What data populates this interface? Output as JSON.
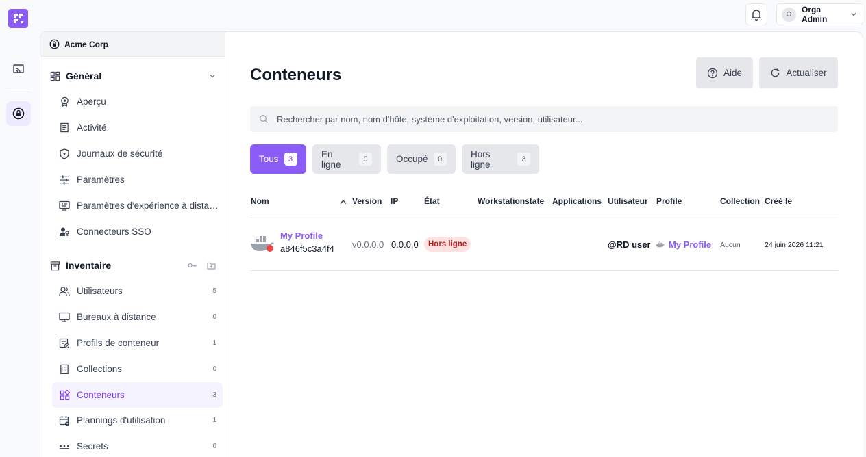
{
  "colors": {
    "accent": "#8b5cf6",
    "offline_bg": "#fee2e2",
    "offline_text": "#b91c1c",
    "offline_dot": "#ef4444"
  },
  "header": {
    "user_initial": "O",
    "user_name": "Orga Admin"
  },
  "sidebar": {
    "org_name": "Acme Corp",
    "general": {
      "title": "Général",
      "items": [
        {
          "label": "Aperçu",
          "icon": "overview-icon"
        },
        {
          "label": "Activité",
          "icon": "activity-icon"
        },
        {
          "label": "Journaux de sécurité",
          "icon": "shield-icon"
        },
        {
          "label": "Paramètres",
          "icon": "sliders-icon"
        },
        {
          "label": "Paramètres d'expérience à distance",
          "icon": "remote-settings-icon"
        },
        {
          "label": "Connecteurs SSO",
          "icon": "user-key-icon"
        }
      ]
    },
    "inventory": {
      "title": "Inventaire",
      "items": [
        {
          "label": "Utilisateurs",
          "count": "5",
          "icon": "users-icon"
        },
        {
          "label": "Bureaux à distance",
          "count": "0",
          "icon": "monitor-icon"
        },
        {
          "label": "Profils de conteneur",
          "count": "1",
          "icon": "container-profile-icon"
        },
        {
          "label": "Collections",
          "count": "0",
          "icon": "collections-icon"
        },
        {
          "label": "Conteneurs",
          "count": "3",
          "icon": "containers-icon",
          "active": true
        },
        {
          "label": "Plannings d'utilisation",
          "count": "1",
          "icon": "calendar-icon"
        },
        {
          "label": "Secrets",
          "count": "0",
          "icon": "secrets-icon"
        }
      ]
    }
  },
  "main": {
    "title": "Conteneurs",
    "help_label": "Aide",
    "refresh_label": "Actualiser",
    "search_placeholder": "Rechercher par nom, nom d'hôte, système d'exploitation, version, utilisateur...",
    "filters": [
      {
        "label": "Tous",
        "count": "3",
        "active": true
      },
      {
        "label": "En ligne",
        "count": "0"
      },
      {
        "label": "Occupé",
        "count": "0"
      },
      {
        "label": "Hors ligne",
        "count": "3"
      }
    ],
    "table": {
      "columns": [
        "Nom",
        "Version",
        "IP",
        "État",
        "Workstationstate",
        "Applications",
        "Utilisateur",
        "Profile",
        "Collection",
        "Créé le"
      ],
      "rows": [
        {
          "name": "My Profile",
          "id": "a846f5c3a4f4",
          "version": "v0.0.0.0",
          "ip": "0.0.0.0",
          "state": "Hors ligne",
          "workstationstate": "",
          "applications": "",
          "user": "@RD user",
          "profile": "My Profile",
          "collection": "Aucun",
          "created": "24 juin 2026 11:21"
        }
      ]
    }
  }
}
